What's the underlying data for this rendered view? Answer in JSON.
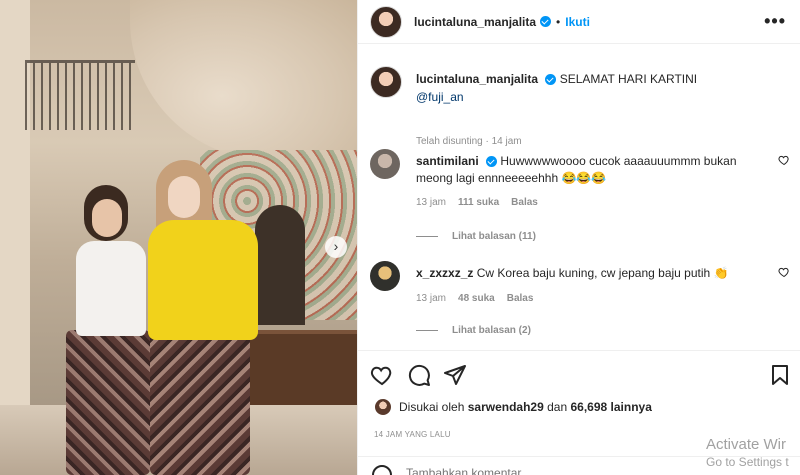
{
  "post": {
    "author": "lucintaluna_manjalita",
    "follow_label": "Ikuti",
    "dot": "•",
    "more_label": "•••",
    "next_label": "›"
  },
  "caption": {
    "author": "lucintaluna_manjalita",
    "text": "SELAMAT HARI KARTINI",
    "mention": "@fuji_an",
    "meta": "Telah disunting · 14 jam"
  },
  "comments": [
    {
      "user": "santimilani",
      "text": "Huwwwwwoooo cucok aaaauuummm bukan meong lagi ennneeeeehhh 😂😂😂",
      "time": "13 jam",
      "likes": "111 suka",
      "reply": "Balas",
      "view_replies": "Lihat balasan (11)"
    },
    {
      "user": "x_zxzxz_z",
      "text": "Cw Korea baju kuning, cw jepang baju putih 👏",
      "time": "13 jam",
      "likes": "48 suka",
      "reply": "Balas",
      "view_replies": "Lihat balasan (2)"
    }
  ],
  "likes": {
    "prefix": "Disukai oleh",
    "user": "sarwendah29",
    "middle": "dan",
    "count": "66,698 lainnya"
  },
  "timestamp": "14 JAM YANG LALU",
  "add_comment": {
    "placeholder": "Tambahkan komentar..."
  },
  "watermark": {
    "title": "Activate Wir",
    "subtitle": "Go to Settings t"
  },
  "colors": {
    "accent": "#0095f6",
    "text": "#262626",
    "muted": "#8e8e8e"
  }
}
